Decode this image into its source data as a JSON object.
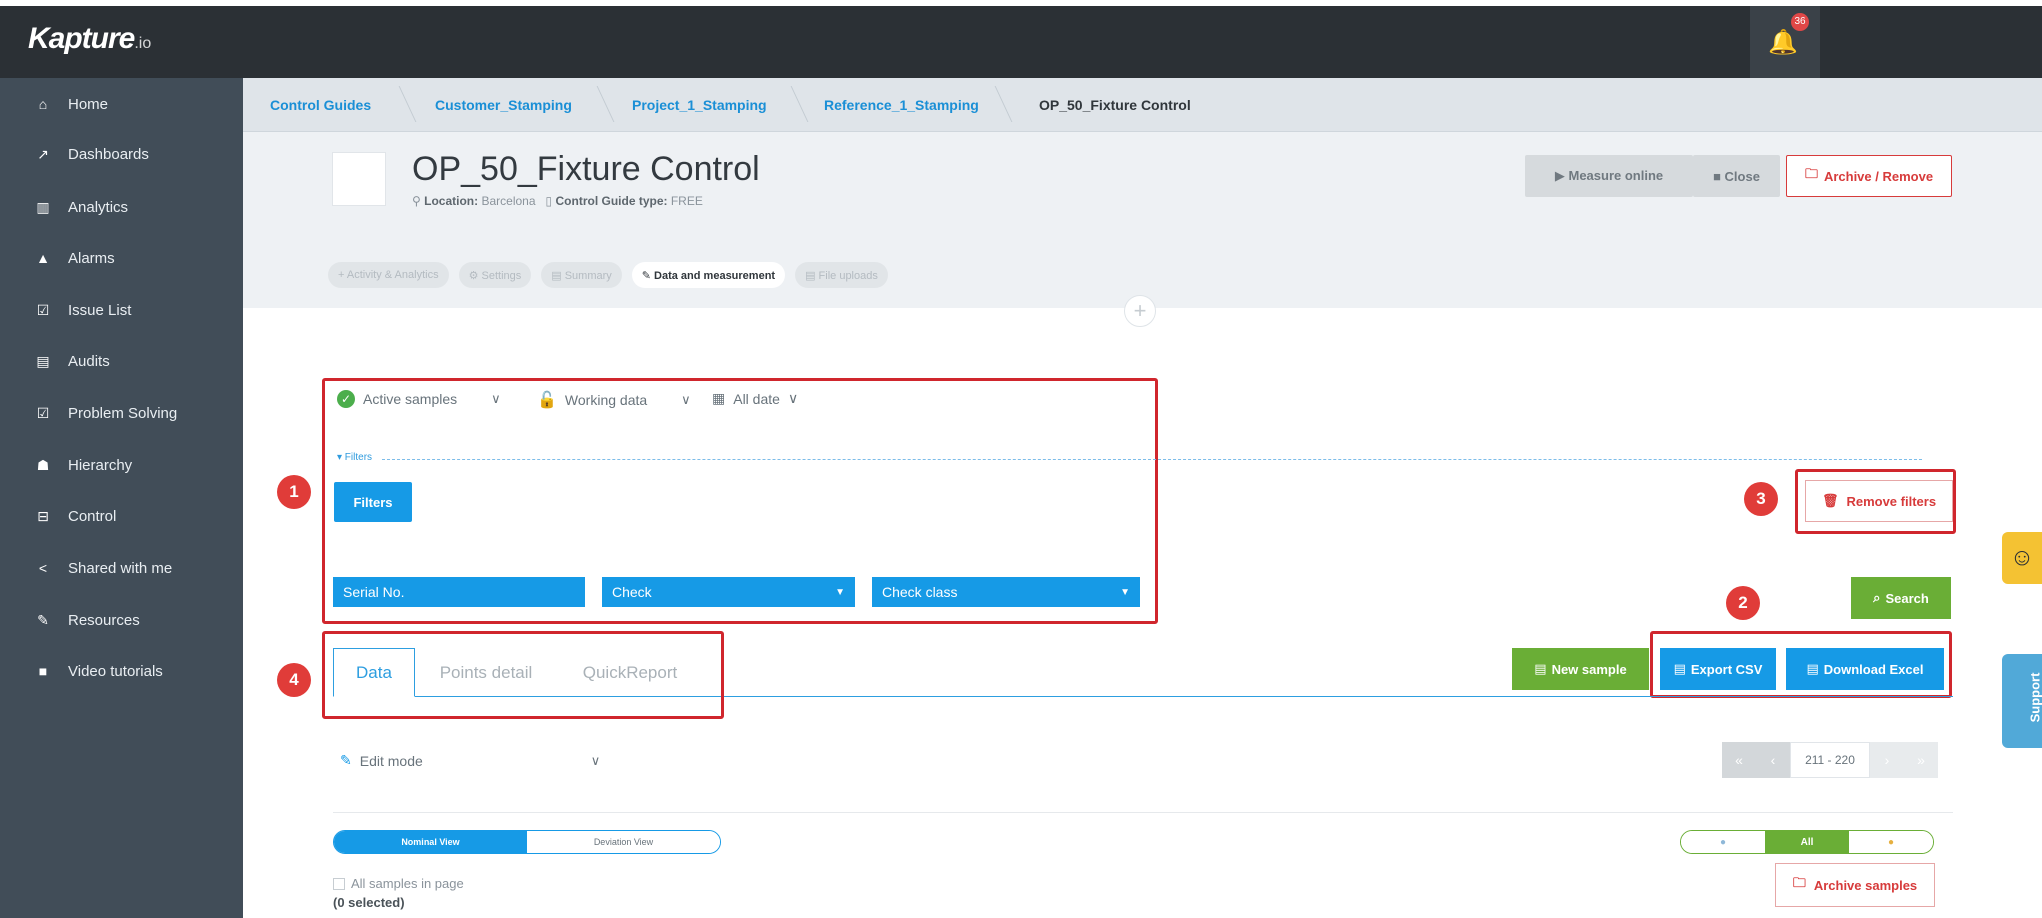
{
  "topbar": {
    "logo": "Kapture",
    "logo_suffix": ".io",
    "notification_count": "36"
  },
  "sidebar": {
    "items": [
      {
        "label": "Home",
        "icon": "home-icon",
        "glyph": "⌂"
      },
      {
        "label": "Dashboards",
        "icon": "line-chart-icon",
        "glyph": "📈"
      },
      {
        "label": "Analytics",
        "icon": "bar-chart-icon",
        "glyph": "▥"
      },
      {
        "label": "Alarms",
        "icon": "warning-icon",
        "glyph": "▲"
      },
      {
        "label": "Issue List",
        "icon": "checkbox-icon",
        "glyph": "☑"
      },
      {
        "label": "Audits",
        "icon": "document-icon",
        "glyph": "▤"
      },
      {
        "label": "Problem Solving",
        "icon": "checkbox-icon",
        "glyph": "☑"
      },
      {
        "label": "Hierarchy",
        "icon": "users-icon",
        "glyph": "☗"
      },
      {
        "label": "Control",
        "icon": "inbox-icon",
        "glyph": "⊟"
      },
      {
        "label": "Shared with me",
        "icon": "share-icon",
        "glyph": "<"
      },
      {
        "label": "Resources",
        "icon": "wrench-icon",
        "glyph": "✎"
      },
      {
        "label": "Video tutorials",
        "icon": "video-icon",
        "glyph": "■"
      }
    ]
  },
  "breadcrumb": {
    "items": [
      "Control Guides",
      "Customer_Stamping",
      "Project_1_Stamping",
      "Reference_1_Stamping",
      "OP_50_Fixture Control"
    ]
  },
  "header": {
    "title": "OP_50_Fixture Control",
    "location_label": "Location:",
    "location_value": "Barcelona",
    "type_label": "Control Guide type:",
    "type_value": "FREE",
    "buttons": {
      "measure": "▶ Measure online",
      "close": "■ Close",
      "archive": "Archive / Remove"
    }
  },
  "subtabs": [
    {
      "label": "+ Activity & Analytics",
      "active": false
    },
    {
      "label": "⚙ Settings",
      "active": false
    },
    {
      "label": "▤ Summary",
      "active": false
    },
    {
      "label": "✎ Data and measurement",
      "active": true
    },
    {
      "label": "▤ File uploads",
      "active": false
    }
  ],
  "filters": {
    "samples_select": "Active samples",
    "data_select": "Working data",
    "date_select": "All date",
    "toggle_label": "▾ Filters",
    "filters_button": "Filters",
    "fields": {
      "serial": "Serial No.",
      "check": "Check",
      "check_class": "Check class"
    },
    "remove_filters": "Remove filters",
    "search": "Search"
  },
  "annotations": [
    "1",
    "2",
    "3",
    "4"
  ],
  "data_tabs": [
    {
      "label": "Data",
      "active": true
    },
    {
      "label": "Points detail",
      "active": false
    },
    {
      "label": "QuickReport",
      "active": false
    }
  ],
  "actions": {
    "new_sample": "New sample",
    "export_csv": "Export CSV",
    "download_excel": "Download Excel"
  },
  "edit_mode": "Edit mode",
  "pager": {
    "range": "211 - 220"
  },
  "view_toggle": {
    "nominal": "Nominal View",
    "deviation": "Deviation View",
    "active": "Nominal View"
  },
  "status_toggle": {
    "minus": "●",
    "all": "All",
    "plus": "●",
    "active": "All"
  },
  "selection": {
    "all_samples": "All samples in page",
    "selected": "(0 selected)"
  },
  "archive_samples": "Archive samples",
  "side_tabs": {
    "support": "Support",
    "feedback": "☺"
  },
  "colors": {
    "sidebar": "#414d58",
    "topbar": "#2b3035",
    "primary": "#169ae6",
    "success": "#6aae36",
    "danger": "#d73b3b",
    "annotation": "#d0262d"
  }
}
